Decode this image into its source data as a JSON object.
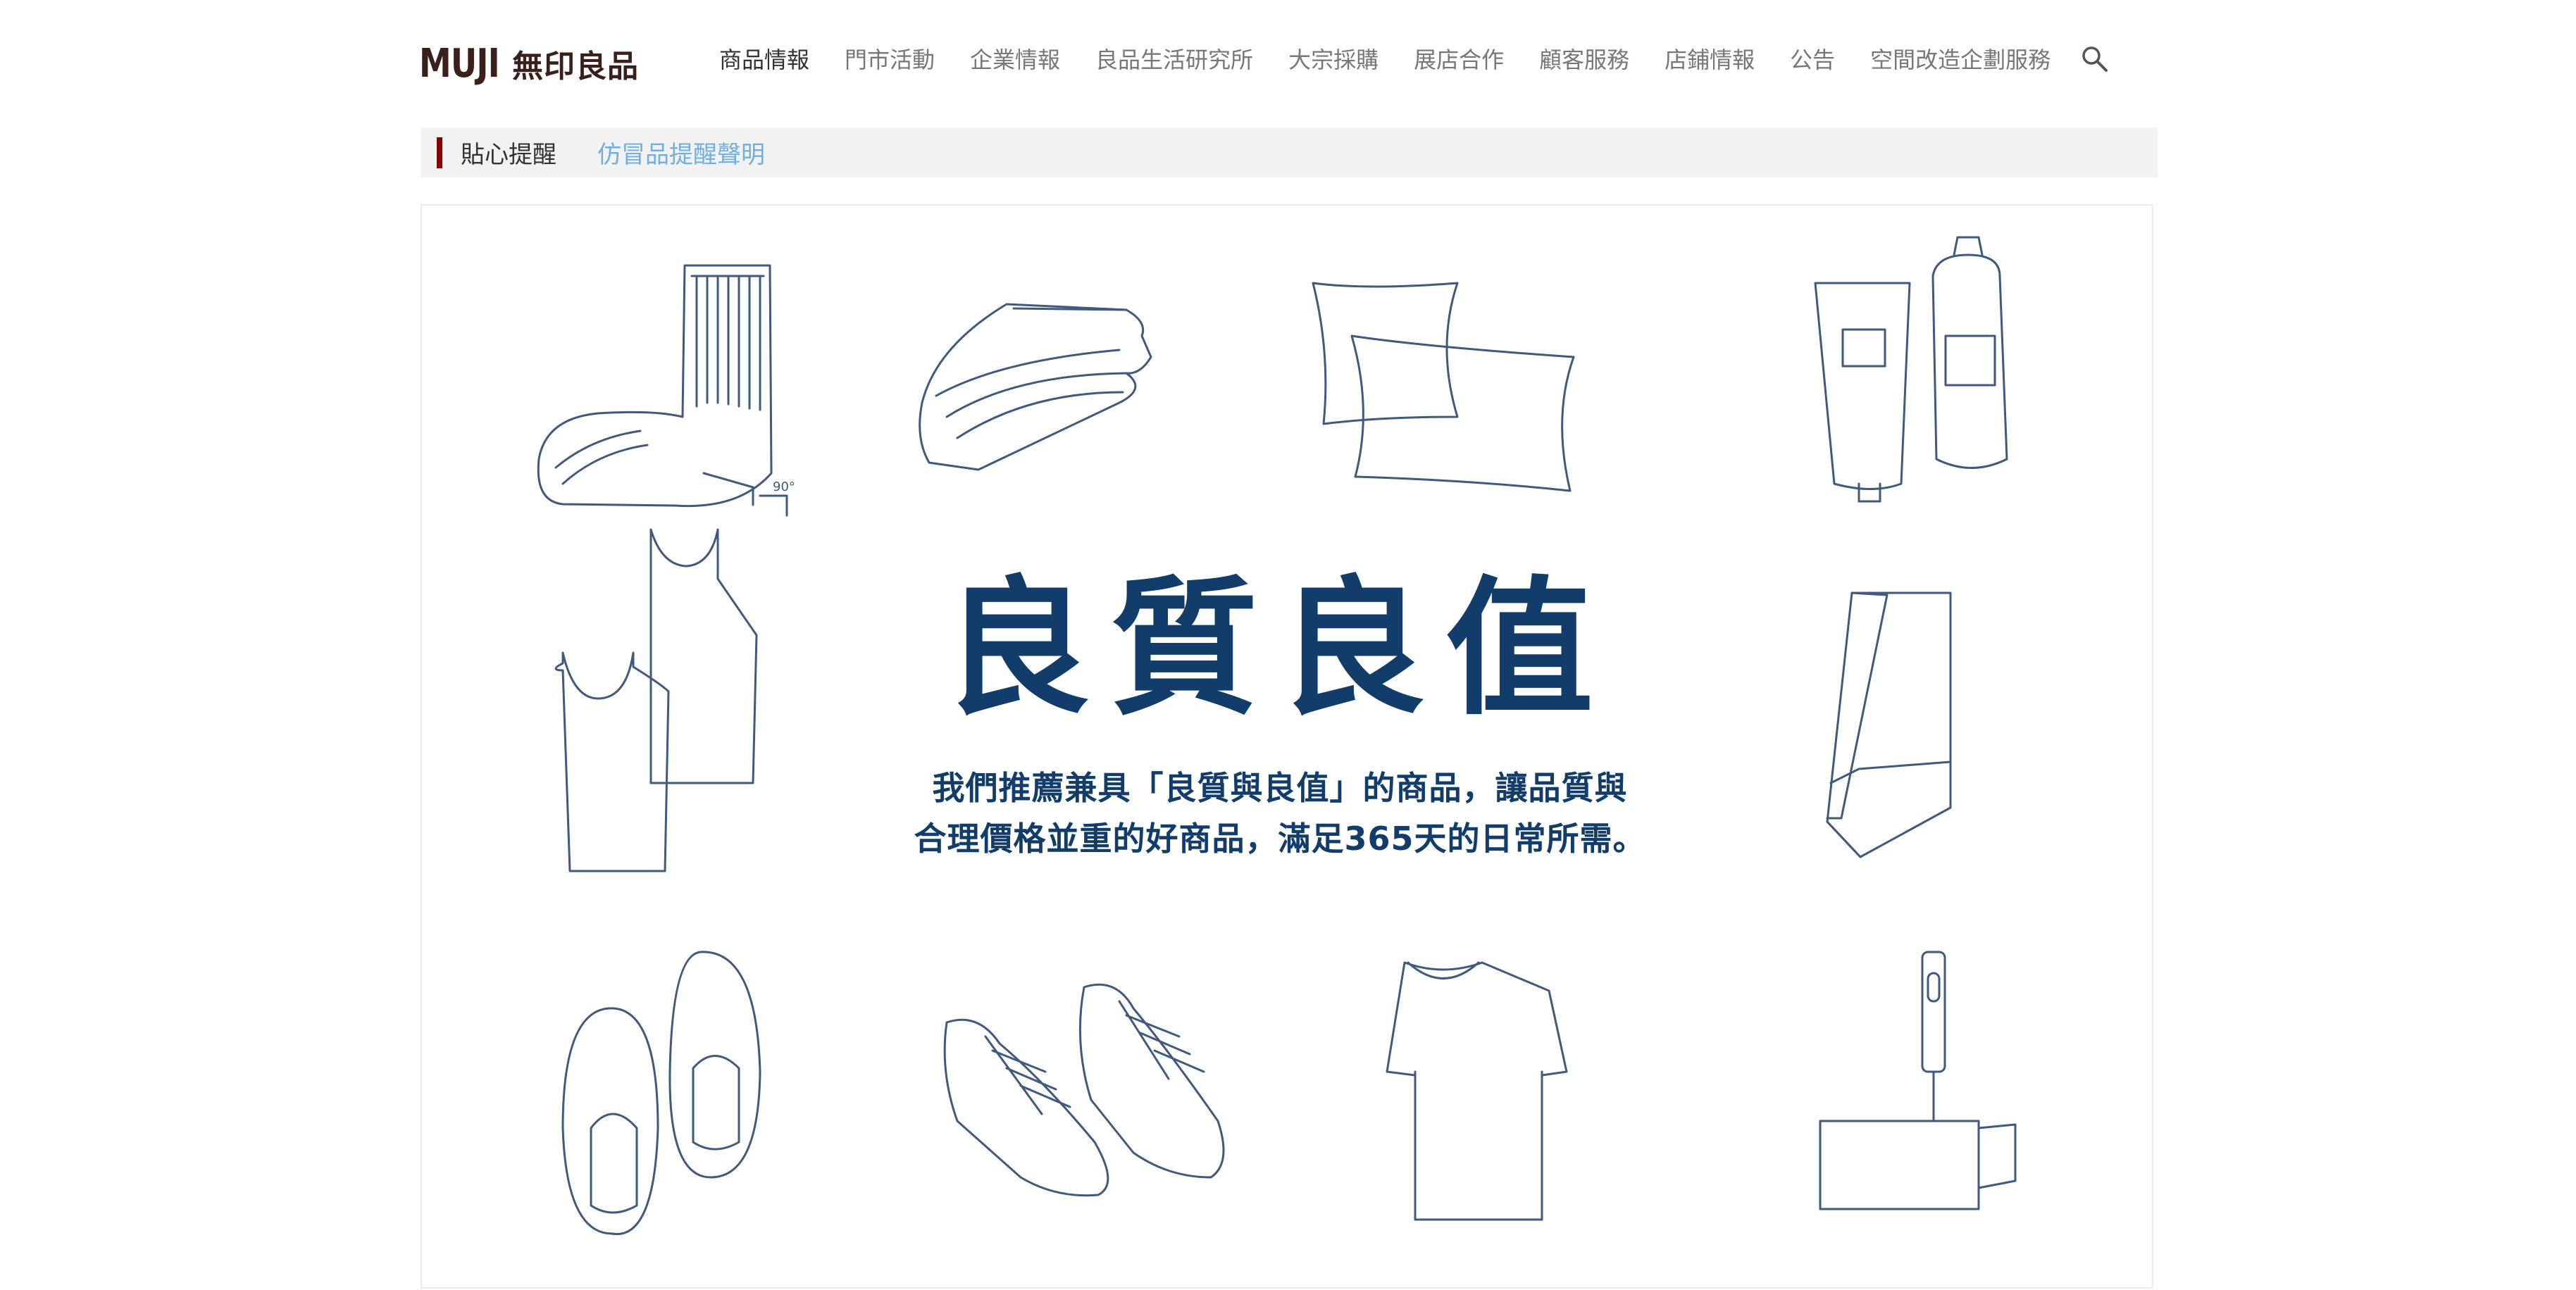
{
  "header": {
    "logo_en": "MUJI",
    "logo_jp": "無印良品",
    "nav": [
      "商品情報",
      "門市活動",
      "企業情報",
      "良品生活研究所",
      "大宗採購",
      "展店合作",
      "顧客服務",
      "店鋪情報",
      "公告",
      "空間改造企劃服務"
    ],
    "active_nav": "商品情報",
    "search_icon": "search-icon"
  },
  "notice": {
    "label": "貼心提醒",
    "link": "仿冒品提醒聲明",
    "accent_color": "#8b0000",
    "link_color": "#6fb0e0"
  },
  "banner": {
    "title": "良質良值",
    "subtitle_line1": "我們推薦兼具「良質與良值」的商品，讓品質與",
    "subtitle_line2": "合理價格並重的好商品，滿足365天的日常所需。",
    "title_color": "#123d6b",
    "sock_angle_label": "90°",
    "illustrations": [
      "sock",
      "folded-towel",
      "pillows",
      "skincare-bottles",
      "camisoles",
      "file-box",
      "slippers",
      "sneakers",
      "t-shirt",
      "lint-roller"
    ]
  }
}
